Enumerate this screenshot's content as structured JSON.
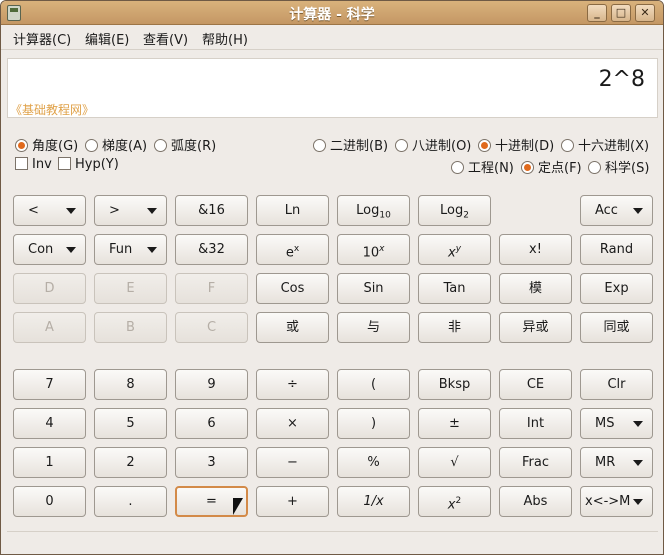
{
  "window": {
    "title": "计算器 - 科学",
    "btn_min": "_",
    "btn_max": "□",
    "btn_close": "✕"
  },
  "menu": [
    "计算器(C)",
    "编辑(E)",
    "查看(V)",
    "帮助(H)"
  ],
  "display": {
    "value": "2^8",
    "footer": "《基础教程网》"
  },
  "angle": {
    "deg": "角度(G)",
    "grad": "梯度(A)",
    "rad": "弧度(R)",
    "selected": "角度(G)"
  },
  "base": {
    "bin": "二进制(B)",
    "oct": "八进制(O)",
    "dec": "十进制(D)",
    "hex": "十六进制(X)",
    "selected": "十进制(D)"
  },
  "flags": {
    "inv": "Inv",
    "hyp": "Hyp(Y)"
  },
  "notation": {
    "eng": "工程(N)",
    "fixed": "定点(F)",
    "sci": "科学(S)",
    "selected": "定点(F)"
  },
  "buttons": {
    "lt": "<",
    "gt": ">",
    "and16": "&16",
    "ln": "Ln",
    "log10": "Log",
    "log10_sub": "10",
    "log2": "Log",
    "log2_sub": "2",
    "acc": "Acc",
    "con": "Con",
    "fun": "Fun",
    "and32": "&32",
    "ex": "e",
    "ex_sup": "x",
    "tenx": "10",
    "tenx_sup": "x",
    "xy": "x",
    "xy_sup": "y",
    "fact": "x!",
    "rand": "Rand",
    "d": "D",
    "e": "E",
    "f": "F",
    "cos": "Cos",
    "sin": "Sin",
    "tan": "Tan",
    "mod": "模",
    "exp": "Exp",
    "a": "A",
    "b": "B",
    "c": "C",
    "or": "或",
    "and": "与",
    "not": "非",
    "xor": "异或",
    "xnor": "同或",
    "n7": "7",
    "n8": "8",
    "n9": "9",
    "div": "÷",
    "lparen": "(",
    "bksp": "Bksp",
    "ce": "CE",
    "clr": "Clr",
    "n4": "4",
    "n5": "5",
    "n6": "6",
    "mul": "×",
    "rparen": ")",
    "pm": "±",
    "int": "Int",
    "ms": "MS",
    "n1": "1",
    "n2": "2",
    "n3": "3",
    "sub": "−",
    "pct": "%",
    "sqrt": "√",
    "frac": "Frac",
    "mr": "MR",
    "n0": "0",
    "dot": ".",
    "eq": "=",
    "add": "+",
    "recip": "1/x",
    "sq": "x",
    "sq_sup": "2",
    "abs": "Abs",
    "xm": "x<->M"
  }
}
